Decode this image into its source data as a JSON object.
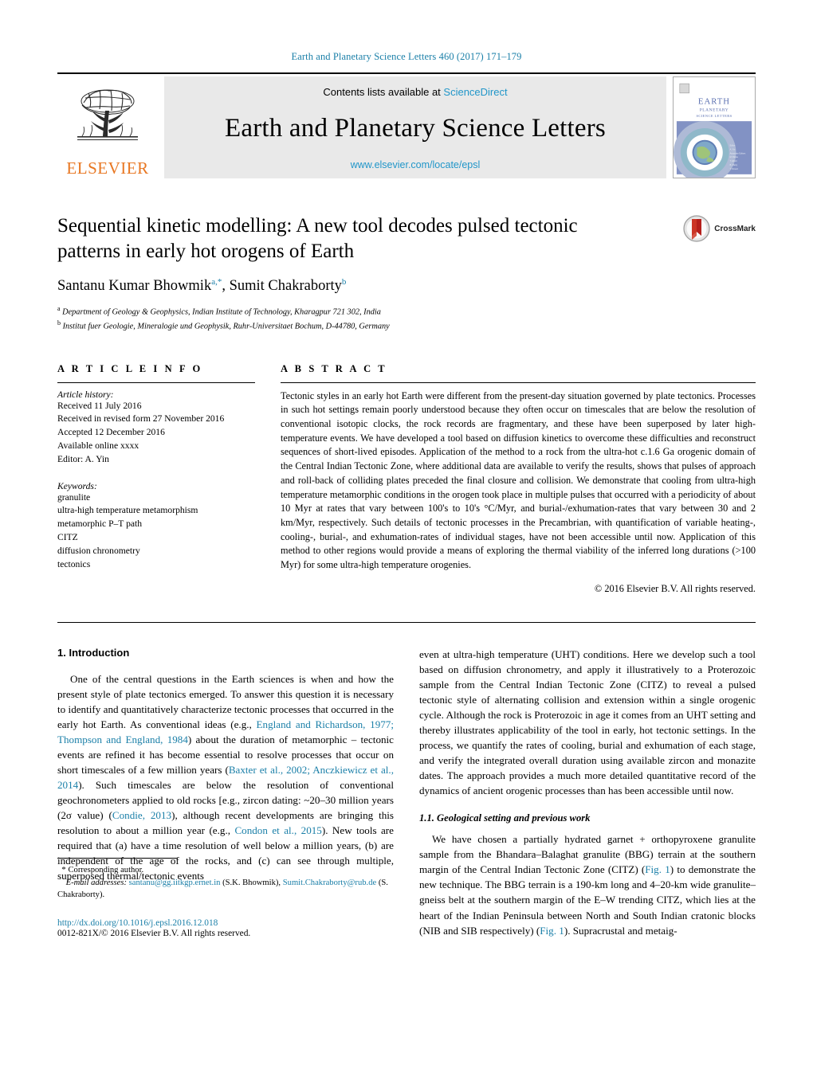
{
  "runninghead": "Earth and Planetary Science Letters 460 (2017) 171–179",
  "masthead": {
    "contents_prefix": "Contents lists available at ",
    "sciencedirect": "ScienceDirect",
    "journal_title": "Earth and Planetary Science Letters",
    "journal_url": "www.elsevier.com/locate/epsl",
    "publisher_wordmark": "ELSEVIER",
    "cover_title_line1": "EARTH",
    "cover_title_line2": "PLANETARY",
    "cover_title_line3": "SCIENCE LETTERS"
  },
  "title": {
    "line1": "Sequential kinetic modelling: A new tool decodes pulsed tectonic",
    "line2": "patterns in early hot orogens of Earth",
    "full": "Sequential kinetic modelling: A new tool decodes pulsed tectonic patterns in early hot orogens of Earth"
  },
  "crossmark": {
    "label": "CrossMark"
  },
  "authors": {
    "author1": "Santanu Kumar Bhowmik",
    "author1_sup": "a,",
    "author1_star": "*",
    "separator": ", ",
    "author2": "Sumit Chakraborty",
    "author2_sup": "b"
  },
  "affiliations": [
    {
      "marker": "a",
      "text": "Department of Geology & Geophysics, Indian Institute of Technology, Kharagpur 721 302, India"
    },
    {
      "marker": "b",
      "text": "Institut fuer Geologie, Mineralogie und Geophysik, Ruhr-Universitaet Bochum, D-44780, Germany"
    }
  ],
  "article_info": {
    "heading": "A R T I C L E   I N F O",
    "history_label": "Article history:",
    "history": [
      "Received 11 July 2016",
      "Received in revised form 27 November 2016",
      "Accepted 12 December 2016",
      "Available online xxxx",
      "Editor: A. Yin"
    ],
    "keywords_label": "Keywords:",
    "keywords": [
      "granulite",
      "ultra-high temperature metamorphism",
      "metamorphic P–T path",
      "CITZ",
      "diffusion chronometry",
      "tectonics"
    ]
  },
  "abstract": {
    "heading": "A B S T R A C T",
    "text": "Tectonic styles in an early hot Earth were different from the present-day situation governed by plate tectonics. Processes in such hot settings remain poorly understood because they often occur on timescales that are below the resolution of conventional isotopic clocks, the rock records are fragmentary, and these have been superposed by later high-temperature events. We have developed a tool based on diffusion kinetics to overcome these difficulties and reconstruct sequences of short-lived episodes. Application of the method to a rock from the ultra-hot c.1.6 Ga orogenic domain of the Central Indian Tectonic Zone, where additional data are available to verify the results, shows that pulses of approach and roll-back of colliding plates preceded the final closure and collision. We demonstrate that cooling from ultra-high temperature metamorphic conditions in the orogen took place in multiple pulses that occurred with a periodicity of about 10 Myr at rates that vary between 100's to 10's °C/Myr, and burial-/exhumation-rates that vary between 30 and 2 km/Myr, respectively. Such details of tectonic processes in the Precambrian, with quantification of variable heating-, cooling-, burial-, and exhumation-rates of individual stages, have not been accessible until now. Application of this method to other regions would provide a means of exploring the thermal viability of the inferred long durations (>100 Myr) for some ultra-high temperature orogenies.",
    "copyright": "© 2016 Elsevier B.V. All rights reserved."
  },
  "body": {
    "section1_heading": "1. Introduction",
    "section11_heading": "1.1. Geological setting and previous work",
    "left_para1_a": "One of the central questions in the Earth sciences is when and how the present style of plate tectonics emerged. To answer this question it is necessary to identify and quantitatively characterize tectonic processes that occurred in the early hot Earth. As conventional ideas (e.g., ",
    "left_ref1": "England and Richardson, 1977; Thompson and England, 1984",
    "left_para1_b": ") about the duration of metamorphic – tectonic events are refined it has become essential to resolve processes that occur on short timescales of a few million years (",
    "left_ref2": "Baxter et al., 2002; Anczkiewicz et al., 2014",
    "left_para1_c": "). Such timescales are below the resolution of conventional geochronometers applied to old rocks [e.g., zircon dating: ~20–30 million years (2σ value) (",
    "left_ref3": "Condie, 2013",
    "left_para1_d": "), although recent developments are bringing this resolution to about a million year (e.g., ",
    "left_ref4": "Condon et al., 2015",
    "left_para1_e": "). New tools are required that (a) have a time resolution of well below a million years, (b) are independent of the age of the rocks, and (c) can see through multiple, superposed thermal/tectonic events",
    "right_para1_a": "even at ultra-high temperature (UHT) conditions. Here we develop such a tool based on diffusion chronometry, and apply it illustratively to a Proterozoic sample from the Central Indian Tectonic Zone (CITZ) to reveal a pulsed tectonic style of alternating collision and extension within a single orogenic cycle. Although the rock is Proterozoic in age it comes from an UHT setting and thereby illustrates applicability of the tool in early, hot tectonic settings. In the process, we quantify the rates of cooling, burial and exhumation of each stage, and verify the integrated overall duration using available zircon and monazite dates. The approach provides a much more detailed quantitative record of the dynamics of ancient orogenic processes than has been accessible until now.",
    "right_para2_a": "We have chosen a partially hydrated garnet + orthopyroxene granulite sample from the Bhandara–Balaghat granulite (BBG) terrain at the southern margin of the Central Indian Tectonic Zone (CITZ) (",
    "right_ref1": "Fig. 1",
    "right_para2_b": ") to demonstrate the new technique. The BBG terrain is a 190-km long and 4–20-km wide granulite–gneiss belt at the southern margin of the E–W trending CITZ, which lies at the heart of the Indian Peninsula between North and South Indian cratonic blocks (NIB and SIB respectively) (",
    "right_ref2": "Fig. 1",
    "right_para2_c": "). Supracrustal and metaig-"
  },
  "footnotes": {
    "corresponding_star": "*",
    "corresponding_text": "Corresponding author.",
    "email_label": "E-mail addresses:",
    "email1": "santanu@gg.iitkgp.ernet.in",
    "email1_owner": " (S.K. Bhowmik),",
    "email2": "Sumit.Chakraborty@rub.de",
    "email2_owner": " (S. Chakraborty).",
    "doi": "http://dx.doi.org/10.1016/j.epsl.2016.12.018",
    "issn": "0012-821X/© 2016 Elsevier B.V. All rights reserved."
  },
  "colors": {
    "link": "#1a7fa8",
    "sciencedirect": "#2196c9",
    "elsevier_orange": "#e87722",
    "masthead_bg": "#e9e9e9"
  }
}
